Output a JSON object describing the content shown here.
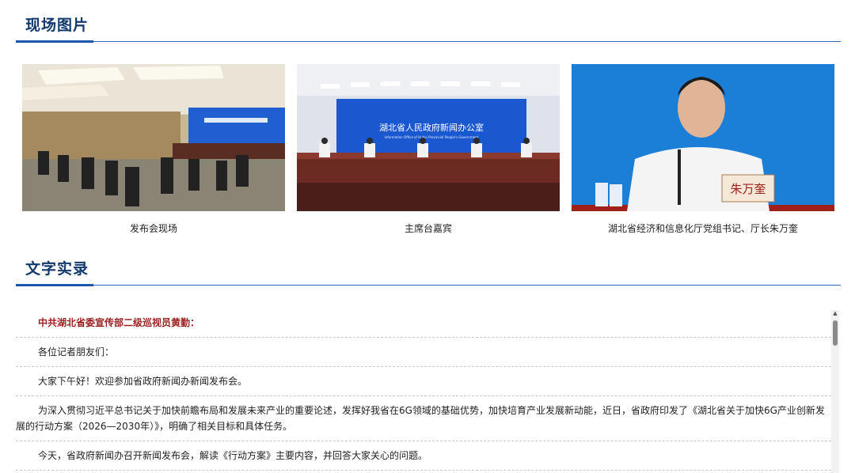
{
  "sections": {
    "photos_title": "现场图片",
    "text_title": "文字实录"
  },
  "photos": [
    {
      "caption": "发布会现场"
    },
    {
      "caption": "主席台嘉宾"
    },
    {
      "caption": "湖北省经济和信息化厅党组书记、厅长朱万奎"
    }
  ],
  "photo_signs": {
    "screen_cn": "湖北省人民政府新闻办公室",
    "screen_en": "Information Office of Hubei Provincial People's Government",
    "nameplate": "朱万奎"
  },
  "transcript": {
    "speaker": "中共湖北省委宣传部二级巡视员黄勤：",
    "paragraphs": [
      "各位记者朋友们：",
      "大家下午好！欢迎参加省政府新闻办新闻发布会。",
      "为深入贯彻习近平总书记关于加快前瞻布局和发展未来产业的重要论述，发挥好我省在6G领域的基础优势，加快培育产业发展新动能，近日，省政府印发了《湖北省关于加快6G产业创新发展的行动方案（2026—2030年）》，明确了相关目标和具体任务。",
      "今天，省政府新闻办召开新闻发布会，解读《行动方案》主要内容，并回答大家关心的问题。"
    ]
  },
  "colors": {
    "title": "#123a6e",
    "accent": "#1d56b0",
    "speaker": "#9a1f1f"
  }
}
